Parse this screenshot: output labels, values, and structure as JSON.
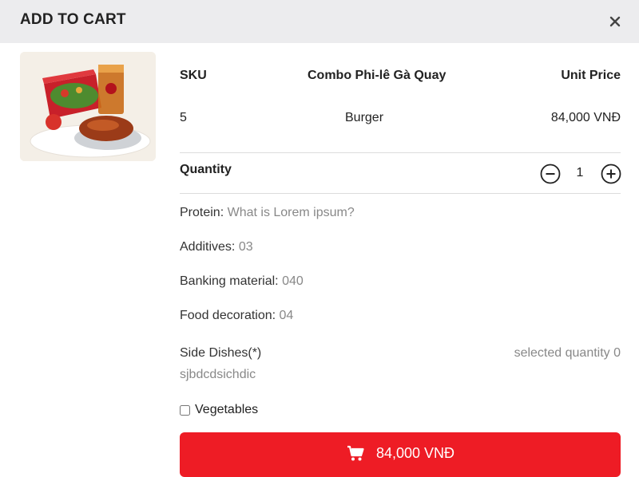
{
  "modal": {
    "title": "ADD TO CART"
  },
  "product": {
    "headers": {
      "sku": "SKU",
      "name": "Combo Phi-lê Gà Quay",
      "unit_price": "Unit Price"
    },
    "values": {
      "sku": "5",
      "name": "Burger",
      "unit_price": "84,000 VNĐ"
    }
  },
  "quantity": {
    "label": "Quantity",
    "value": "1"
  },
  "attributes": [
    {
      "label": "Protein:",
      "value": "What is Lorem ipsum?"
    },
    {
      "label": "Additives:",
      "value": "03"
    },
    {
      "label": "Banking material:",
      "value": "040"
    },
    {
      "label": "Food decoration:",
      "value": "04"
    }
  ],
  "side_dishes": {
    "title": "Side Dishes(*)",
    "selected_quantity": "selected quantity 0",
    "subtitle": "sjbdcdsichdic",
    "options": [
      {
        "label": "Vegetables",
        "checked": false
      }
    ]
  },
  "add_button": {
    "label": "84,000 VNĐ",
    "icon": "cart-icon"
  },
  "colors": {
    "accent": "#ee1c25",
    "header_bg": "#ececee"
  }
}
